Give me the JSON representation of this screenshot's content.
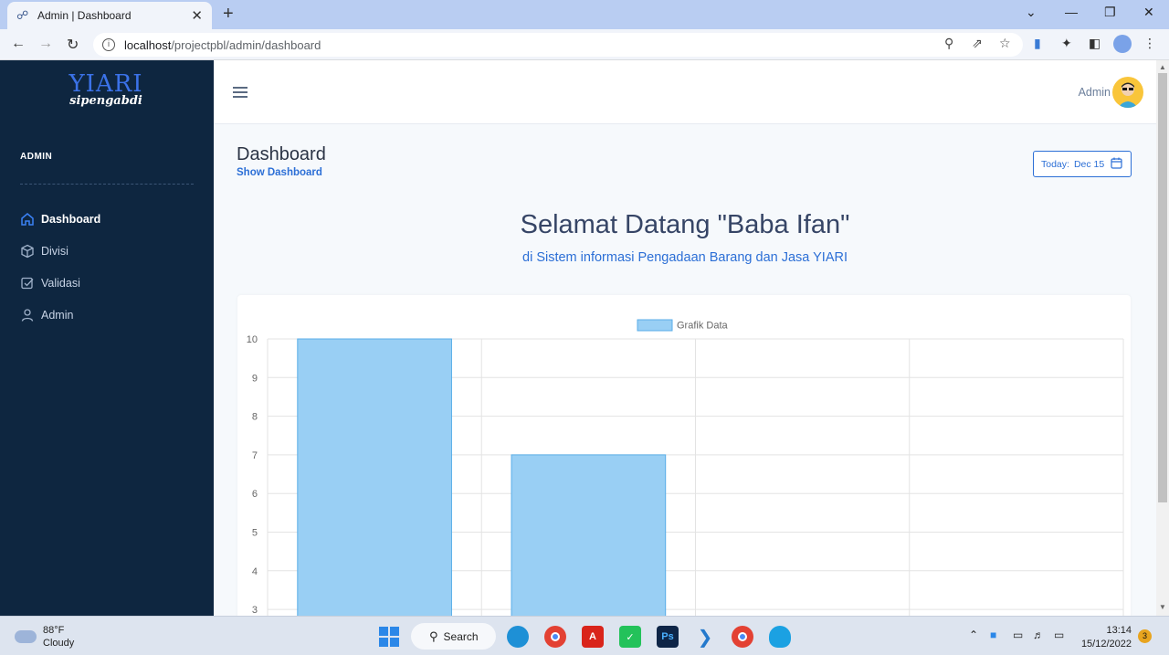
{
  "browser": {
    "tab_title": "Admin | Dashboard",
    "url_host": "localhost",
    "url_path": "/projectpbl/admin/dashboard"
  },
  "sidebar": {
    "logo_main": "YIARI",
    "logo_sub": "sipengabdi",
    "heading": "ADMIN",
    "items": [
      {
        "label": "Dashboard",
        "icon": "home-icon",
        "active": true
      },
      {
        "label": "Divisi",
        "icon": "box-icon",
        "active": false
      },
      {
        "label": "Validasi",
        "icon": "check-square-icon",
        "active": false
      },
      {
        "label": "Admin",
        "icon": "user-icon",
        "active": false
      }
    ]
  },
  "topbar": {
    "user_name": "Admin"
  },
  "page": {
    "title": "Dashboard",
    "subtitle": "Show Dashboard",
    "today_label": "Today:",
    "today_value": "Dec 15",
    "welcome": "Selamat Datang \"Baba Ifan\"",
    "welcome_sub": "di Sistem informasi Pengadaan Barang dan Jasa YIARI"
  },
  "chart_data": {
    "type": "bar",
    "series": [
      {
        "name": "Grafik Data",
        "values": [
          10,
          7,
          null,
          null
        ]
      }
    ],
    "categories": [
      "",
      "",
      "",
      ""
    ],
    "y_ticks": [
      10,
      9,
      8,
      7,
      6,
      5,
      4,
      3
    ],
    "ylim": [
      0,
      10
    ],
    "legend": "top-center",
    "grid": true,
    "bar_fill": "#99cff4",
    "bar_stroke": "#5aaee8"
  },
  "taskbar": {
    "temperature": "88°F",
    "weather": "Cloudy",
    "search_label": "Search",
    "time": "13:14",
    "date": "15/12/2022",
    "notifications": "3"
  },
  "colors": {
    "sidebar_bg": "#0e2640",
    "accent": "#2c6fd6",
    "heading": "#364566"
  }
}
